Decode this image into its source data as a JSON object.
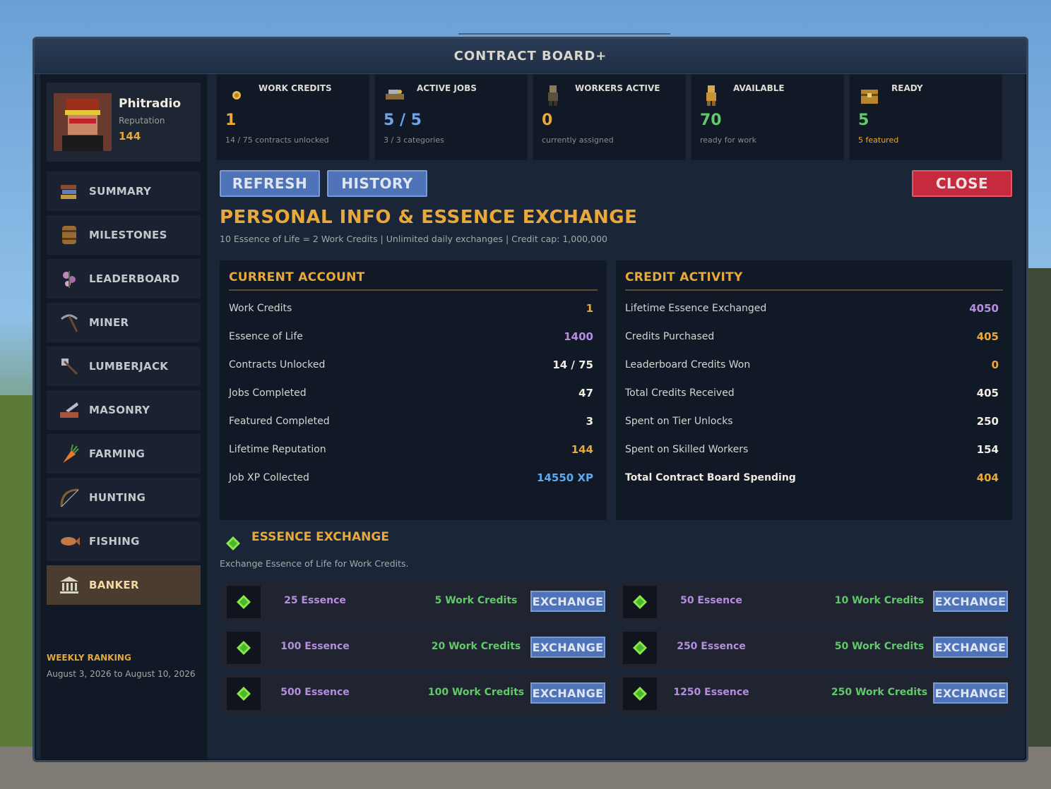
{
  "window": {
    "title": "CONTRACT BOARD+"
  },
  "profile": {
    "name": "Phitradio",
    "reputation_label": "Reputation",
    "reputation_value": "144"
  },
  "nav": [
    {
      "label": "SUMMARY",
      "icon": "books-icon"
    },
    {
      "label": "MILESTONES",
      "icon": "barrel-icon"
    },
    {
      "label": "LEADERBOARD",
      "icon": "flower-icon"
    },
    {
      "label": "MINER",
      "icon": "pickaxe-icon"
    },
    {
      "label": "LUMBERJACK",
      "icon": "axe-icon"
    },
    {
      "label": "MASONRY",
      "icon": "trowel-icon"
    },
    {
      "label": "FARMING",
      "icon": "carrot-icon"
    },
    {
      "label": "HUNTING",
      "icon": "bow-icon"
    },
    {
      "label": "FISHING",
      "icon": "fish-icon"
    },
    {
      "label": "BANKER",
      "icon": "bank-icon",
      "active": true
    }
  ],
  "weekly": {
    "title": "WEEKLY RANKING",
    "dates": "August 3, 2026 to August 10, 2026"
  },
  "stats": [
    {
      "label": "WORK CREDITS",
      "value": "1",
      "sub": "14 / 75 contracts unlocked",
      "icon": "coin-icon",
      "color": "#e8a83a"
    },
    {
      "label": "ACTIVE JOBS",
      "value": "5 / 5",
      "sub": "3 / 3 categories",
      "icon": "tools-icon",
      "color": "#6fa4e8"
    },
    {
      "label": "WORKERS ACTIVE",
      "value": "0",
      "sub": "currently assigned",
      "icon": "worker-icon",
      "color": "#e8a83a"
    },
    {
      "label": "AVAILABLE",
      "value": "70",
      "sub": "ready for work",
      "icon": "worker-available-icon",
      "color": "#62c86a"
    },
    {
      "label": "READY",
      "value": "5",
      "sub": "5 featured",
      "icon": "chest-icon",
      "color": "#62c86a",
      "sub_color": "#e8a83a"
    }
  ],
  "buttons": {
    "refresh": "REFRESH",
    "history": "HISTORY",
    "close": "CLOSE"
  },
  "section": {
    "title": "PERSONAL INFO & ESSENCE EXCHANGE",
    "subtitle": "10 Essence of Life = 2 Work Credits | Unlimited daily exchanges | Credit cap: 1,000,000"
  },
  "current_account": {
    "title": "CURRENT ACCOUNT",
    "rows": [
      {
        "label": "Work Credits",
        "value": "1",
        "color": "#e8a83a"
      },
      {
        "label": "Essence of Life",
        "value": "1400",
        "color": "#b58ee0"
      },
      {
        "label": "Contracts Unlocked",
        "value": "14 / 75",
        "color": "#f0ede4"
      },
      {
        "label": "Jobs Completed",
        "value": "47",
        "color": "#f0ede4"
      },
      {
        "label": "Featured Completed",
        "value": "3",
        "color": "#f0ede4"
      },
      {
        "label": "Lifetime Reputation",
        "value": "144",
        "color": "#e8a83a"
      },
      {
        "label": "Job XP Collected",
        "value": "14550 XP",
        "color": "#5ea8f0"
      }
    ]
  },
  "credit_activity": {
    "title": "CREDIT ACTIVITY",
    "rows": [
      {
        "label": "Lifetime Essence Exchanged",
        "value": "4050",
        "color": "#b58ee0"
      },
      {
        "label": "Credits Purchased",
        "value": "405",
        "color": "#e8a83a"
      },
      {
        "label": "Leaderboard Credits Won",
        "value": "0",
        "color": "#e8a83a"
      },
      {
        "label": "Total Credits Received",
        "value": "405",
        "color": "#f0ede4"
      },
      {
        "label": "Spent on Tier Unlocks",
        "value": "250",
        "color": "#f0ede4"
      },
      {
        "label": "Spent on Skilled Workers",
        "value": "154",
        "color": "#f0ede4"
      },
      {
        "label": "Total Contract Board Spending",
        "value": "404",
        "color": "#e8a83a",
        "bold": true
      }
    ]
  },
  "exchange": {
    "title": "ESSENCE EXCHANGE",
    "subtitle": "Exchange Essence of Life for Work Credits.",
    "button_label": "EXCHANGE",
    "offers": [
      {
        "essence": "25 Essence",
        "credits": "5 Work Credits"
      },
      {
        "essence": "50 Essence",
        "credits": "10 Work Credits"
      },
      {
        "essence": "100 Essence",
        "credits": "20 Work Credits"
      },
      {
        "essence": "250 Essence",
        "credits": "50 Work Credits"
      },
      {
        "essence": "500 Essence",
        "credits": "100 Work Credits"
      },
      {
        "essence": "1250 Essence",
        "credits": "250 Work Credits"
      }
    ]
  }
}
